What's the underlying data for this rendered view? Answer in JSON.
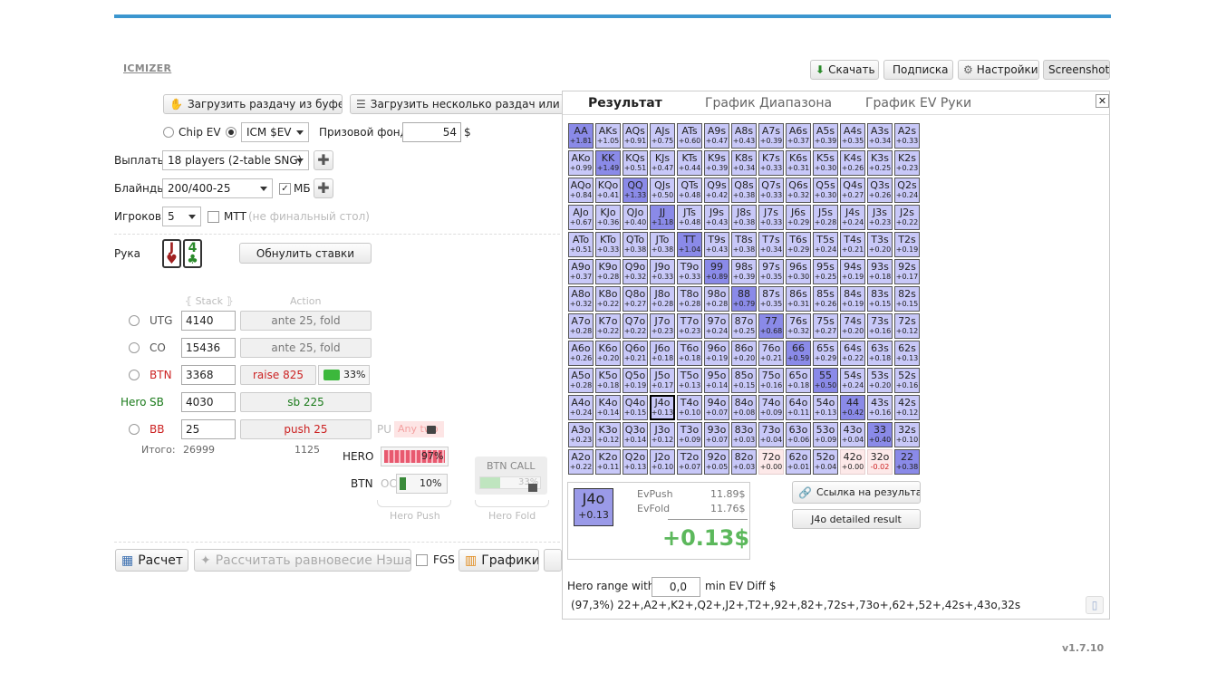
{
  "colors": {
    "accent": "#3b96cf",
    "range_strong": "#8a8ae8",
    "range_light": "#c8c8f8",
    "negative_cell": "#fde9e9",
    "ev_green": "#5cb85c",
    "red": "#cc2222",
    "hero_green": "#1a7a1a"
  },
  "header": {
    "logo": "ICMIZER",
    "download": "Скачать",
    "subscribe": "Подписка",
    "settings": "Настройки",
    "screenshot": "Screenshot"
  },
  "loaders": {
    "buffer": "Загрузить раздачу из буфера",
    "multi": "Загрузить несколько раздач или тур"
  },
  "settings": {
    "chip_ev": "Chip EV",
    "icm_ev": "ICM $EV",
    "prize_label": "Призовой фонд",
    "prize_value": "54",
    "currency": "$",
    "payouts_label": "Выплаты",
    "payouts_value": "18 players (2-table SNG)",
    "blinds_label": "Блайнды",
    "blinds_value": "200/400-25",
    "mb": "МБ",
    "players_label": "Игроков",
    "players_value": "5",
    "mtt": "МТТ",
    "mtt_note": "(не финальный стол)"
  },
  "hand": {
    "label": "Рука",
    "card1_rank": "J",
    "card1_suit": "♥",
    "card2_rank": "4",
    "card2_suit": "♣",
    "reset": "Обнулить ставки"
  },
  "table_head": {
    "stack": "Stack",
    "action": "Action"
  },
  "players": [
    {
      "prefix": "",
      "pos": "UTG",
      "stack": "4140",
      "action": "ante 25, fold",
      "style": "normal"
    },
    {
      "prefix": "",
      "pos": "CO",
      "stack": "15436",
      "action": "ante 25, fold",
      "style": "normal"
    },
    {
      "prefix": "",
      "pos": "BTN",
      "stack": "3368",
      "action": "raise 825",
      "style": "red",
      "extra": "33%"
    },
    {
      "prefix": "Hero",
      "pos": "SB",
      "stack": "4030",
      "action": "sb 225",
      "style": "hero"
    },
    {
      "prefix": "",
      "pos": "BB",
      "stack": "25",
      "action": "push 25",
      "style": "red",
      "pu": "PU",
      "any": "Any two"
    }
  ],
  "totals": {
    "label": "Итого:",
    "stack": "26999",
    "action": "1125"
  },
  "hero_bars": {
    "hero": "HERO",
    "hero_pct": "97%",
    "btn": "BTN",
    "oc": "OC",
    "btn_pct": "10%",
    "btn_call": "BTN CALL",
    "btn_call_pct": "33%",
    "hero_push": "Hero Push",
    "hero_fold": "Hero Fold"
  },
  "bottom": {
    "calc": "Расчет",
    "nash": "Рассчитать равновесие Нэша",
    "fgs": "FGS",
    "charts": "Графики"
  },
  "tabs": [
    "Результат",
    "График Диапазона",
    "График EV Руки"
  ],
  "grid": [
    [
      [
        "AA",
        "+1.81"
      ],
      [
        "AKs",
        "+1.05"
      ],
      [
        "AQs",
        "+0.91"
      ],
      [
        "AJs",
        "+0.75"
      ],
      [
        "ATs",
        "+0.60"
      ],
      [
        "A9s",
        "+0.47"
      ],
      [
        "A8s",
        "+0.43"
      ],
      [
        "A7s",
        "+0.39"
      ],
      [
        "A6s",
        "+0.37"
      ],
      [
        "A5s",
        "+0.39"
      ],
      [
        "A4s",
        "+0.35"
      ],
      [
        "A3s",
        "+0.34"
      ],
      [
        "A2s",
        "+0.33"
      ]
    ],
    [
      [
        "AKo",
        "+0.99"
      ],
      [
        "KK",
        "+1.49"
      ],
      [
        "KQs",
        "+0.51"
      ],
      [
        "KJs",
        "+0.47"
      ],
      [
        "KTs",
        "+0.44"
      ],
      [
        "K9s",
        "+0.39"
      ],
      [
        "K8s",
        "+0.34"
      ],
      [
        "K7s",
        "+0.33"
      ],
      [
        "K6s",
        "+0.31"
      ],
      [
        "K5s",
        "+0.30"
      ],
      [
        "K4s",
        "+0.26"
      ],
      [
        "K3s",
        "+0.25"
      ],
      [
        "K2s",
        "+0.23"
      ]
    ],
    [
      [
        "AQo",
        "+0.84"
      ],
      [
        "KQo",
        "+0.41"
      ],
      [
        "QQ",
        "+1.33"
      ],
      [
        "QJs",
        "+0.50"
      ],
      [
        "QTs",
        "+0.48"
      ],
      [
        "Q9s",
        "+0.42"
      ],
      [
        "Q8s",
        "+0.38"
      ],
      [
        "Q7s",
        "+0.33"
      ],
      [
        "Q6s",
        "+0.32"
      ],
      [
        "Q5s",
        "+0.30"
      ],
      [
        "Q4s",
        "+0.27"
      ],
      [
        "Q3s",
        "+0.26"
      ],
      [
        "Q2s",
        "+0.24"
      ]
    ],
    [
      [
        "AJo",
        "+0.67"
      ],
      [
        "KJo",
        "+0.36"
      ],
      [
        "QJo",
        "+0.40"
      ],
      [
        "JJ",
        "+1.18"
      ],
      [
        "JTs",
        "+0.48"
      ],
      [
        "J9s",
        "+0.43"
      ],
      [
        "J8s",
        "+0.38"
      ],
      [
        "J7s",
        "+0.33"
      ],
      [
        "J6s",
        "+0.29"
      ],
      [
        "J5s",
        "+0.28"
      ],
      [
        "J4s",
        "+0.24"
      ],
      [
        "J3s",
        "+0.23"
      ],
      [
        "J2s",
        "+0.22"
      ]
    ],
    [
      [
        "ATo",
        "+0.51"
      ],
      [
        "KTo",
        "+0.33"
      ],
      [
        "QTo",
        "+0.38"
      ],
      [
        "JTo",
        "+0.38"
      ],
      [
        "TT",
        "+1.04"
      ],
      [
        "T9s",
        "+0.43"
      ],
      [
        "T8s",
        "+0.38"
      ],
      [
        "T7s",
        "+0.34"
      ],
      [
        "T6s",
        "+0.29"
      ],
      [
        "T5s",
        "+0.24"
      ],
      [
        "T4s",
        "+0.21"
      ],
      [
        "T3s",
        "+0.20"
      ],
      [
        "T2s",
        "+0.19"
      ]
    ],
    [
      [
        "A9o",
        "+0.37"
      ],
      [
        "K9o",
        "+0.28"
      ],
      [
        "Q9o",
        "+0.32"
      ],
      [
        "J9o",
        "+0.33"
      ],
      [
        "T9o",
        "+0.33"
      ],
      [
        "99",
        "+0.89"
      ],
      [
        "98s",
        "+0.39"
      ],
      [
        "97s",
        "+0.35"
      ],
      [
        "96s",
        "+0.30"
      ],
      [
        "95s",
        "+0.25"
      ],
      [
        "94s",
        "+0.19"
      ],
      [
        "93s",
        "+0.18"
      ],
      [
        "92s",
        "+0.17"
      ]
    ],
    [
      [
        "A8o",
        "+0.32"
      ],
      [
        "K8o",
        "+0.22"
      ],
      [
        "Q8o",
        "+0.27"
      ],
      [
        "J8o",
        "+0.28"
      ],
      [
        "T8o",
        "+0.28"
      ],
      [
        "98o",
        "+0.28"
      ],
      [
        "88",
        "+0.79"
      ],
      [
        "87s",
        "+0.35"
      ],
      [
        "86s",
        "+0.31"
      ],
      [
        "85s",
        "+0.26"
      ],
      [
        "84s",
        "+0.19"
      ],
      [
        "83s",
        "+0.15"
      ],
      [
        "82s",
        "+0.15"
      ]
    ],
    [
      [
        "A7o",
        "+0.28"
      ],
      [
        "K7o",
        "+0.22"
      ],
      [
        "Q7o",
        "+0.22"
      ],
      [
        "J7o",
        "+0.23"
      ],
      [
        "T7o",
        "+0.23"
      ],
      [
        "97o",
        "+0.24"
      ],
      [
        "87o",
        "+0.25"
      ],
      [
        "77",
        "+0.68"
      ],
      [
        "76s",
        "+0.32"
      ],
      [
        "75s",
        "+0.27"
      ],
      [
        "74s",
        "+0.20"
      ],
      [
        "73s",
        "+0.16"
      ],
      [
        "72s",
        "+0.12"
      ]
    ],
    [
      [
        "A6o",
        "+0.26"
      ],
      [
        "K6o",
        "+0.20"
      ],
      [
        "Q6o",
        "+0.21"
      ],
      [
        "J6o",
        "+0.18"
      ],
      [
        "T6o",
        "+0.18"
      ],
      [
        "96o",
        "+0.19"
      ],
      [
        "86o",
        "+0.20"
      ],
      [
        "76o",
        "+0.21"
      ],
      [
        "66",
        "+0.59"
      ],
      [
        "65s",
        "+0.29"
      ],
      [
        "64s",
        "+0.22"
      ],
      [
        "63s",
        "+0.18"
      ],
      [
        "62s",
        "+0.13"
      ]
    ],
    [
      [
        "A5o",
        "+0.28"
      ],
      [
        "K5o",
        "+0.18"
      ],
      [
        "Q5o",
        "+0.19"
      ],
      [
        "J5o",
        "+0.17"
      ],
      [
        "T5o",
        "+0.13"
      ],
      [
        "95o",
        "+0.14"
      ],
      [
        "85o",
        "+0.15"
      ],
      [
        "75o",
        "+0.16"
      ],
      [
        "65o",
        "+0.18"
      ],
      [
        "55",
        "+0.50"
      ],
      [
        "54s",
        "+0.24"
      ],
      [
        "53s",
        "+0.20"
      ],
      [
        "52s",
        "+0.16"
      ]
    ],
    [
      [
        "A4o",
        "+0.24"
      ],
      [
        "K4o",
        "+0.14"
      ],
      [
        "Q4o",
        "+0.15"
      ],
      [
        "J4o",
        "+0.13"
      ],
      [
        "T4o",
        "+0.10"
      ],
      [
        "94o",
        "+0.07"
      ],
      [
        "84o",
        "+0.08"
      ],
      [
        "74o",
        "+0.09"
      ],
      [
        "64o",
        "+0.11"
      ],
      [
        "54o",
        "+0.13"
      ],
      [
        "44",
        "+0.42"
      ],
      [
        "43s",
        "+0.16"
      ],
      [
        "42s",
        "+0.12"
      ]
    ],
    [
      [
        "A3o",
        "+0.23"
      ],
      [
        "K3o",
        "+0.12"
      ],
      [
        "Q3o",
        "+0.14"
      ],
      [
        "J3o",
        "+0.12"
      ],
      [
        "T3o",
        "+0.09"
      ],
      [
        "93o",
        "+0.07"
      ],
      [
        "83o",
        "+0.03"
      ],
      [
        "73o",
        "+0.04"
      ],
      [
        "63o",
        "+0.06"
      ],
      [
        "53o",
        "+0.09"
      ],
      [
        "43o",
        "+0.04"
      ],
      [
        "33",
        "+0.40"
      ],
      [
        "32s",
        "+0.10"
      ]
    ],
    [
      [
        "A2o",
        "+0.22"
      ],
      [
        "K2o",
        "+0.11"
      ],
      [
        "Q2o",
        "+0.13"
      ],
      [
        "J2o",
        "+0.10"
      ],
      [
        "T2o",
        "+0.07"
      ],
      [
        "92o",
        "+0.05"
      ],
      [
        "82o",
        "+0.03"
      ],
      [
        "72o",
        "+0.00"
      ],
      [
        "62o",
        "+0.01"
      ],
      [
        "52o",
        "+0.04"
      ],
      [
        "42o",
        "+0.00"
      ],
      [
        "32o",
        "-0.02"
      ],
      [
        "22",
        "+0.38"
      ]
    ]
  ],
  "summary": {
    "hand": "J4o",
    "ev": "+0.13",
    "evpush_label": "EvPush",
    "evpush": "11.89$",
    "evfold_label": "EvFold",
    "evfold": "11.76$",
    "diff": "+0.13$"
  },
  "links": {
    "result_link": "Ссылка на результат",
    "detailed": "J4o detailed result"
  },
  "range": {
    "label": "Hero range with",
    "value": "0,0",
    "suffix": "min EV Diff $",
    "text": "(97,3%) 22+,A2+,K2+,Q2+,J2+,T2+,92+,82+,72s+,73o+,62+,52+,42s+,43o,32s"
  },
  "version": "v1.7.10"
}
